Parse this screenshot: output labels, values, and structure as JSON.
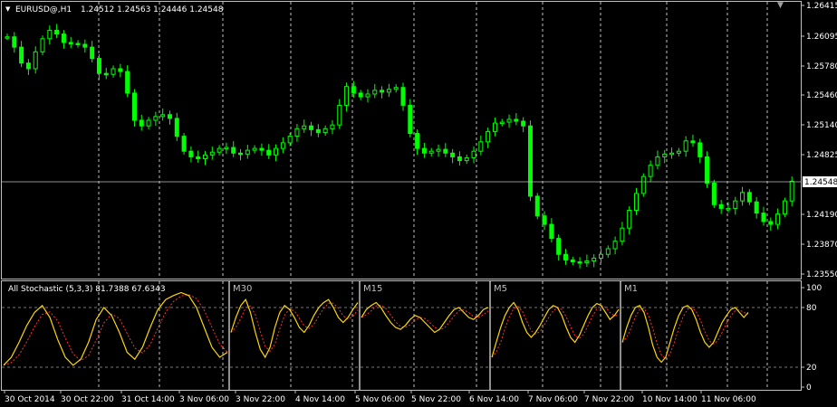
{
  "main_chart": {
    "title": "EURUSD@,H1",
    "ohlc": "1.24512 1.24563 1.24446 1.24548",
    "price_labels": [
      "1.26415",
      "1.26095",
      "1.25780",
      "1.25460",
      "1.25140",
      "1.24825",
      "1.24190",
      "1.23870",
      "1.23550"
    ],
    "current_price": "1.24548",
    "candle_color": "#00ff00",
    "grid_color": "#c0c0c0",
    "bg_color": "#000000",
    "close_series": [
      1.2608,
      1.2597,
      1.258,
      1.2574,
      1.2592,
      1.2606,
      1.2615,
      1.2611,
      1.2602,
      1.2601,
      1.26,
      1.2597,
      1.2585,
      1.2569,
      1.2568,
      1.2574,
      1.2571,
      1.2548,
      1.2519,
      1.2513,
      1.2519,
      1.2523,
      1.2525,
      1.2521,
      1.2502,
      1.2486,
      1.248,
      1.2478,
      1.2482,
      1.2485,
      1.2489,
      1.249,
      1.2484,
      1.2483,
      1.2487,
      1.2489,
      1.2487,
      1.2482,
      1.2489,
      1.2495,
      1.2502,
      1.251,
      1.2513,
      1.2509,
      1.2506,
      1.251,
      1.2514,
      1.2535,
      1.2555,
      1.2548,
      1.2544,
      1.2547,
      1.2551,
      1.2549,
      1.2552,
      1.2554,
      1.2535,
      1.2505,
      1.2489,
      1.2484,
      1.2486,
      1.2488,
      1.2484,
      1.248,
      1.2476,
      1.2479,
      1.2486,
      1.2496,
      1.2507,
      1.2516,
      1.2517,
      1.252,
      1.2518,
      1.2513,
      1.2438,
      1.2417,
      1.2408,
      1.2393,
      1.2376,
      1.237,
      1.2368,
      1.2367,
      1.2369,
      1.2372,
      1.2376,
      1.2382,
      1.239,
      1.2404,
      1.2423,
      1.2441,
      1.2459,
      1.2471,
      1.248,
      1.2483,
      1.2484,
      1.2486,
      1.2497,
      1.2495,
      1.248,
      1.2452,
      1.2429,
      1.2425,
      1.2425,
      1.2433,
      1.2442,
      1.2432,
      1.242,
      1.2411,
      1.2408,
      1.2419,
      1.2433,
      1.2454
    ],
    "ylim": [
      1.2355,
      1.26415
    ]
  },
  "stochastic_panel": {
    "label": "All Stochastic (5,3,3) 81.7388 67.6343",
    "main_line_color": "#ffd700",
    "signal_line_color": "#ff3030",
    "level_labels": [
      "100",
      "80",
      "20",
      "0"
    ],
    "timeframes": [
      "M30",
      "M15",
      "M5",
      "M1"
    ],
    "series_H1": [
      22,
      30,
      45,
      62,
      75,
      82,
      70,
      48,
      30,
      22,
      28,
      45,
      68,
      80,
      72,
      55,
      35,
      28,
      40,
      60,
      78,
      88,
      92,
      95,
      92,
      80,
      60,
      40,
      30,
      35
    ],
    "series_M30": [
      55,
      70,
      82,
      88,
      75,
      55,
      38,
      30,
      40,
      60,
      75,
      82,
      78,
      70,
      60,
      55,
      62,
      72,
      80,
      85,
      88,
      80,
      70,
      65,
      70,
      78,
      85
    ],
    "series_M15": [
      70,
      78,
      82,
      85,
      80,
      72,
      65,
      60,
      58,
      62,
      68,
      72,
      70,
      65,
      60,
      55,
      58,
      65,
      72,
      78,
      80,
      75,
      70,
      68,
      72,
      78,
      80
    ],
    "series_M5": [
      30,
      45,
      60,
      72,
      80,
      85,
      78,
      65,
      55,
      50,
      55,
      62,
      70,
      78,
      82,
      80,
      72,
      60,
      50,
      45,
      52,
      62,
      72,
      80,
      84,
      82,
      75,
      68,
      72,
      78
    ],
    "series_M1": [
      45,
      60,
      72,
      80,
      82,
      75,
      60,
      42,
      30,
      25,
      30,
      45,
      60,
      72,
      80,
      82,
      78,
      68,
      55,
      45,
      40,
      45,
      55,
      65,
      72,
      78,
      80,
      75,
      70,
      75
    ]
  },
  "time_axis": {
    "labels": [
      "30 Oct 2014",
      "30 Oct 22:00",
      "31 Oct 14:00",
      "3 Nov 06:00",
      "3 Nov 22:00",
      "4 Nov 14:00",
      "5 Nov 06:00",
      "5 Nov 22:00",
      "6 Nov 14:00",
      "7 Nov 06:00",
      "7 Nov 22:00",
      "10 Nov 14:00",
      "11 Nov 06:00"
    ]
  }
}
